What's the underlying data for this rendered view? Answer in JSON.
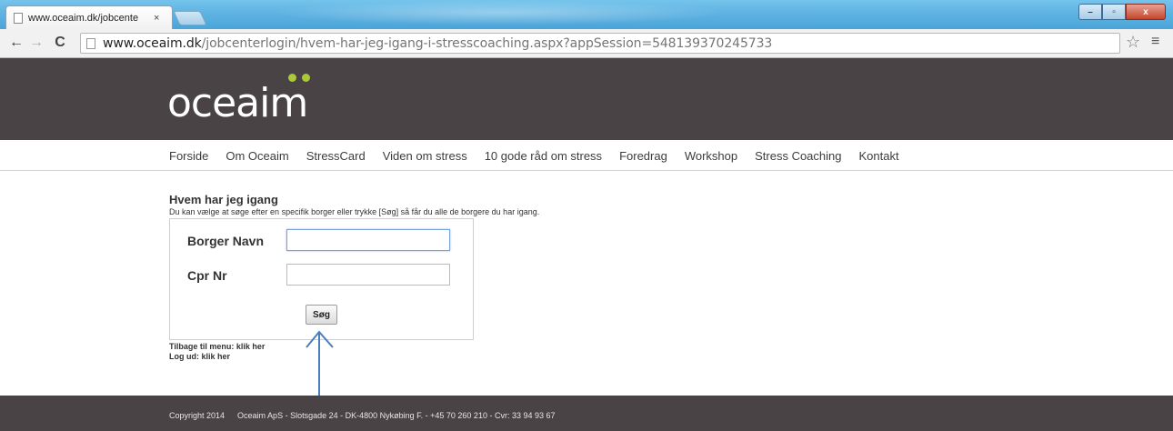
{
  "browser": {
    "tab_title": "www.oceaim.dk/jobcente",
    "tab_close": "×",
    "url_host": "www.oceaim.dk",
    "url_path": "/jobcenterlogin/hvem-har-jeg-igang-i-stresscoaching.aspx?appSession=548139370245733",
    "back_icon": "←",
    "forward_icon": "→",
    "reload_icon": "C",
    "star_icon": "☆",
    "menu_icon": "≡",
    "minimize_icon": "–",
    "maximize_icon": "▫",
    "close_icon": "x"
  },
  "site": {
    "logo_text": "oceaim",
    "logo_dot_color": "#a9c93a",
    "header_color": "#4a4346",
    "nav": [
      "Forside",
      "Om Oceaim",
      "StressCard",
      "Viden om stress",
      "10 gode råd om stress",
      "Foredrag",
      "Workshop",
      "Stress Coaching",
      "Kontakt"
    ]
  },
  "content": {
    "heading": "Hvem har jeg igang",
    "intro": "Du kan vælge at søge efter en specifik borger eller trykke [Søg] så får du alle de borgere du har igang.",
    "form": {
      "name_label": "Borger Navn",
      "name_value": "",
      "cpr_label": "Cpr Nr",
      "cpr_value": "",
      "search_button": "Søg"
    },
    "back_link": "Tilbage til menu: klik her",
    "logout_link": "Log ud: klik her"
  },
  "annotation": {
    "arrow_color": "#4a7ebb"
  },
  "footer": {
    "copyright": "Copyright 2014",
    "company": "Oceaim ApS - Slotsgade 24 - DK-4800 Nykøbing F. - +45 70 260 210 - Cvr: 33 94 93 67"
  }
}
